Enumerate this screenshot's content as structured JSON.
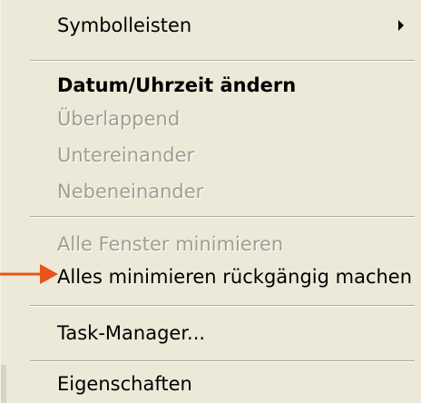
{
  "menu": {
    "items": [
      {
        "label": "Symbolleisten",
        "state": "enabled",
        "has_submenu": true
      },
      {
        "label": "Datum/Uhrzeit ändern",
        "state": "enabled",
        "bold": true
      },
      {
        "label": "Überlappend",
        "state": "disabled"
      },
      {
        "label": "Untereinander",
        "state": "disabled"
      },
      {
        "label": "Nebeneinander",
        "state": "disabled"
      },
      {
        "label": "Alle Fenster minimieren",
        "state": "disabled"
      },
      {
        "label": "Alles minimieren rückgängig machen",
        "state": "enabled",
        "highlighted_by_arrow": true
      },
      {
        "label": "Task-Manager...",
        "state": "enabled"
      },
      {
        "label": "Eigenschaften",
        "state": "enabled"
      }
    ]
  },
  "annotation": {
    "arrow_color": "#e8531a",
    "arrow_icon": "right-arrow-icon"
  },
  "colors": {
    "menu_background": "#ece9d8",
    "disabled_text": "#a19e90",
    "separator": "#aca899"
  }
}
